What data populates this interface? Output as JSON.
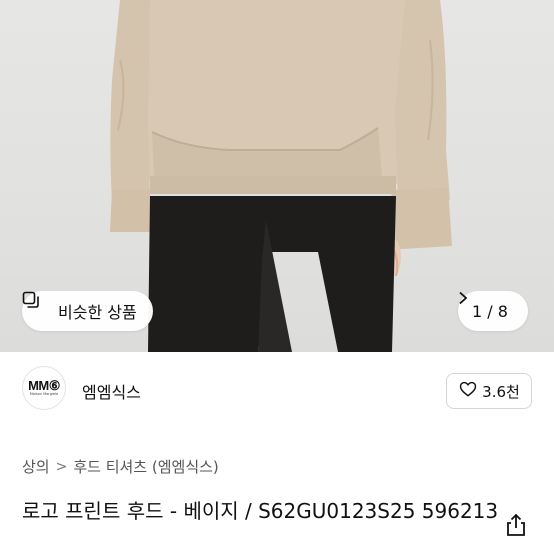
{
  "gallery": {
    "similar_label": "비슷한 상품",
    "pager_text": "1 / 8",
    "icons": {
      "similar": "image-stack-icon",
      "next": "chevron-right-icon"
    }
  },
  "brand": {
    "logo_text": "MM⑥",
    "logo_sub": "Maison Margiela",
    "name": "엠엠식스",
    "likes": "3.6천",
    "icons": {
      "like": "heart-outline-icon"
    }
  },
  "breadcrumb": {
    "category": "상의",
    "separator": ">",
    "subcategory": "후드 티셔츠 (엠엠식스)"
  },
  "product": {
    "title": "로고 프린트 후드 - 베이지 / S62GU0123S25 596213",
    "icons": {
      "share": "share-icon"
    }
  },
  "colors": {
    "hoodie": "#d8c8b3",
    "pants": "#1e1c1b",
    "background": "#e3e3e1"
  }
}
